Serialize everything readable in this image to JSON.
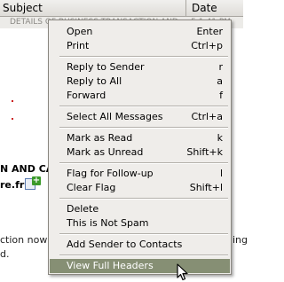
{
  "columns": {
    "subject": "Subject",
    "date": "Date"
  },
  "selected_row_text": "DETAILS OF BUSINESS TRANSACTION AND ... 5 1:41 PM",
  "background": {
    "bold_line1": "N AND CA",
    "bold_line2": "re.fr",
    "plus_glyph": "+",
    "line_a": "ction now",
    "line_a_right": "ing",
    "line_b": "d."
  },
  "context_menu": {
    "groups": [
      [
        {
          "label": "Open",
          "accel": "Enter"
        },
        {
          "label": "Print",
          "accel": "Ctrl+p"
        }
      ],
      [
        {
          "label": "Reply to Sender",
          "accel": "r"
        },
        {
          "label": "Reply to All",
          "accel": "a"
        },
        {
          "label": "Forward",
          "accel": "f"
        }
      ],
      [
        {
          "label": "Select All Messages",
          "accel": "Ctrl+a"
        }
      ],
      [
        {
          "label": "Mark as Read",
          "accel": "k"
        },
        {
          "label": "Mark as Unread",
          "accel": "Shift+k"
        }
      ],
      [
        {
          "label": "Flag for Follow-up",
          "accel": "l"
        },
        {
          "label": "Clear Flag",
          "accel": "Shift+l"
        }
      ],
      [
        {
          "label": "Delete",
          "accel": ""
        },
        {
          "label": "This is Not Spam",
          "accel": ""
        }
      ],
      [
        {
          "label": "Add Sender to Contacts",
          "accel": ""
        }
      ],
      [
        {
          "label": "View Full Headers",
          "accel": "",
          "highlighted": true
        }
      ]
    ]
  },
  "colors": {
    "highlight": "#868f74",
    "menu_bg": "#efedea"
  }
}
